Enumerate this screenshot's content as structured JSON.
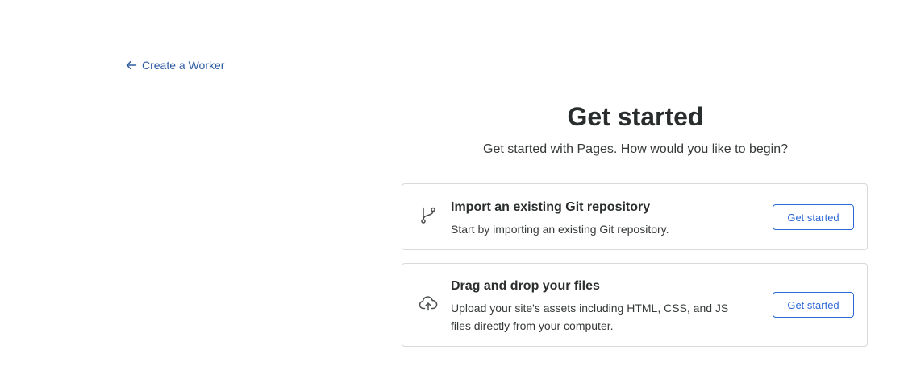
{
  "back_link": {
    "label": "Create a Worker",
    "icon": "arrow-left-icon"
  },
  "header": {
    "title": "Get started",
    "subtitle": "Get started with Pages. How would you like to begin?"
  },
  "options": [
    {
      "icon": "git-branch-icon",
      "title": "Import an existing Git repository",
      "description": "Start by importing an existing Git repository.",
      "button_label": "Get started"
    },
    {
      "icon": "cloud-upload-icon",
      "title": "Drag and drop your files",
      "description": "Upload your site's assets including HTML, CSS, and JS files directly from your computer.",
      "button_label": "Get started"
    }
  ],
  "colors": {
    "link": "#2c5aa0",
    "button_accent": "#2c68d6",
    "border": "#d9d9d9"
  }
}
